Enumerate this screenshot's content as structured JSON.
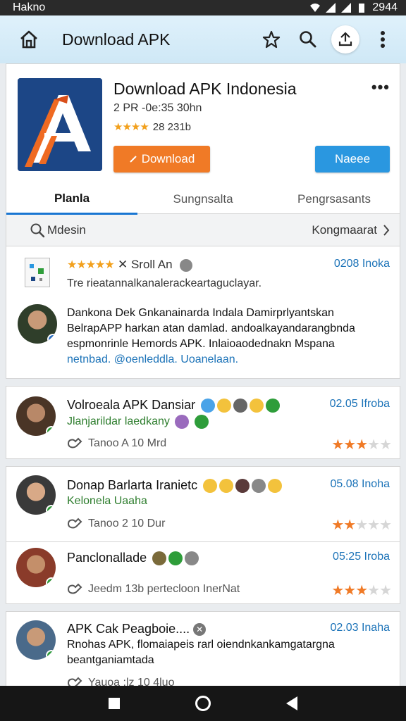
{
  "status_bar": {
    "carrier": "Hakno",
    "time": "2944"
  },
  "app_bar": {
    "title": "Download APK"
  },
  "app": {
    "name": "Download APK Indonesia",
    "meta": "2 PR -0e:35 30hn",
    "rating_text": "28 231b",
    "download_label": "Download",
    "secondary_label": "Naeee",
    "more": "•••"
  },
  "tabs": [
    {
      "label": "Planla"
    },
    {
      "label": "Sungnsalta"
    },
    {
      "label": "Pengrsasants"
    }
  ],
  "search": {
    "label": "Mdesin",
    "sort_label": "Kongmaarat"
  },
  "reviews": [
    {
      "name": "Sroll An",
      "date": "0208 Inoka",
      "line1": "Tre rieatannalkanalerackeartaguclayar.",
      "line2": "Dankona Dek Gnkanainarda Indala Damirprlyantskan",
      "line3": "BelrapAPP harkan atan damlad. andoalkayandarangbnda",
      "line4": "espmonrinle Hemords APK. Inlaioaodednakn Mspana",
      "line5": "netnbad. @oenleddla. Uoanelaan."
    },
    {
      "name": "Volroeala APK Dansiar",
      "date": "02.05 Ifroba",
      "subline": "Jlanjarildar laedkany",
      "footer": "Tanoo A 10 Mrd",
      "stars": 3.5
    },
    {
      "name": "Donap Barlarta Iranietc",
      "date": "05.08 Inoha",
      "subline": "Kelonela Uaaha",
      "footer": "Tanoo 2 10 Dur",
      "stars": 2.5
    },
    {
      "name": "Panclonallade",
      "date": "05:25 Iroba",
      "footer": "Jeedm 13b pertecloon InerNat",
      "stars": 3.5
    },
    {
      "name": "APK Cak Peagboie....",
      "date": "02.03 Inaha",
      "line1": "Rnohas APK, flomaiapeis rarl oiendnkankamgatargna",
      "line2": "beantganiamtada",
      "footer": "Yauoa :lz 10 4luo"
    }
  ],
  "colors": {
    "accent_orange": "#f07a26",
    "accent_blue": "#2a97e0",
    "app_bar": "#d5ecf8",
    "date_blue": "#1c73b8"
  }
}
